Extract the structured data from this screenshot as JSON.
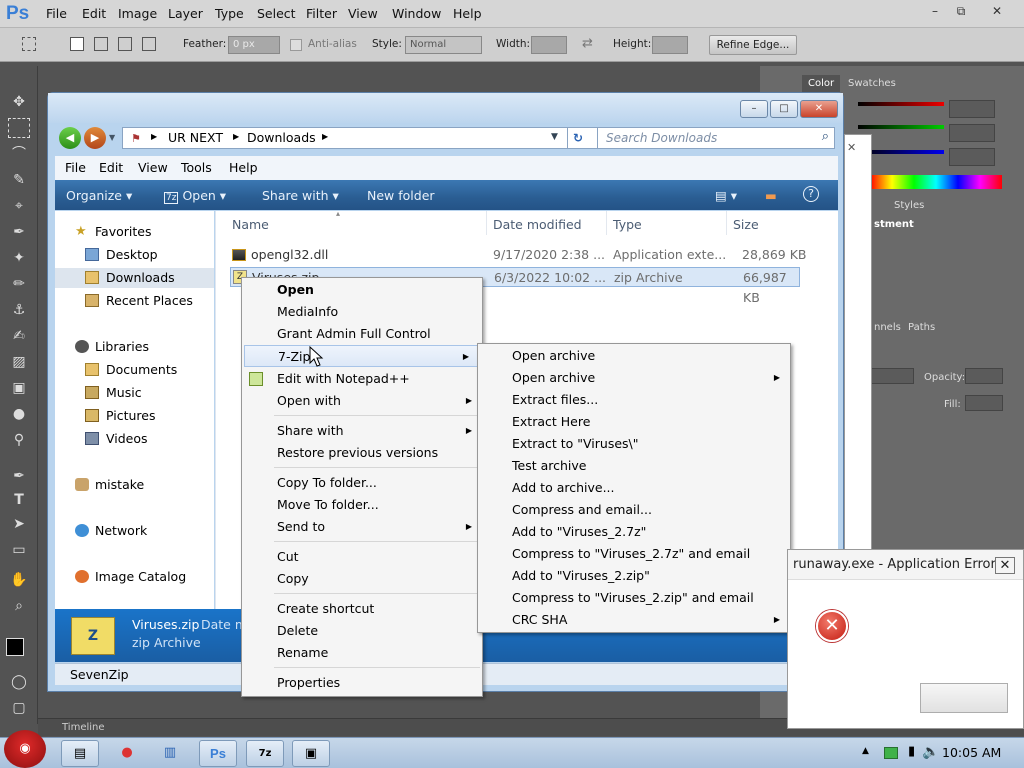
{
  "photoshop": {
    "logo": "Ps",
    "menus": [
      "File",
      "Edit",
      "Image",
      "Layer",
      "Type",
      "Select",
      "Filter",
      "View",
      "Window",
      "Help"
    ],
    "options": {
      "feather_label": "Feather:",
      "feather_value": "0 px",
      "antialias_label": "Anti-alias",
      "style_label": "Style:",
      "style_value": "Normal",
      "width_label": "Width:",
      "height_label": "Height:",
      "refine_edge": "Refine Edge..."
    },
    "panels": {
      "color_tab": "Color",
      "swatches_tab": "Swatches",
      "history_tab": "Styles",
      "adjustments_label": "stment",
      "channels_tab": "nnels",
      "paths_tab": "Paths",
      "opacity_label": "Opacity:",
      "fill_label": "Fill:"
    },
    "timeline": "Timeline"
  },
  "explorer": {
    "breadcrumb": [
      "UR NEXT",
      "Downloads"
    ],
    "search_placeholder": "Search Downloads",
    "menus": [
      "File",
      "Edit",
      "View",
      "Tools",
      "Help"
    ],
    "commands": {
      "organize": "Organize",
      "open": "Open",
      "share_with": "Share with",
      "new_folder": "New folder"
    },
    "nav": {
      "favorites": "Favorites",
      "desktop": "Desktop",
      "downloads": "Downloads",
      "recent": "Recent Places",
      "libraries": "Libraries",
      "documents": "Documents",
      "music": "Music",
      "pictures": "Pictures",
      "videos": "Videos",
      "mistake": "mistake",
      "network": "Network",
      "image_catalog": "Image Catalog"
    },
    "columns": {
      "name": "Name",
      "date": "Date modified",
      "type": "Type",
      "size": "Size"
    },
    "files": [
      {
        "name": "opengl32.dll",
        "date": "9/17/2020 2:38 ...",
        "type": "Application exte...",
        "size": "28,869 KB"
      },
      {
        "name": "Viruses.zip",
        "date": "6/3/2022 10:02 ...",
        "type": "zip Archive",
        "size": "66,987 KB"
      }
    ],
    "details": {
      "name": "Viruses.zip",
      "date_label": "Date m",
      "type": "zip Archive"
    },
    "status": "SevenZip"
  },
  "context_menu": {
    "items": {
      "open": "Open",
      "mediainfo": "MediaInfo",
      "grant": "Grant Admin Full Control",
      "sevenzip": "7-Zip",
      "notepad": "Edit with Notepad++",
      "open_with": "Open with",
      "share_with": "Share with",
      "restore": "Restore previous versions",
      "copy_to": "Copy To folder...",
      "move_to": "Move To folder...",
      "send_to": "Send to",
      "cut": "Cut",
      "copy": "Copy",
      "create_shortcut": "Create shortcut",
      "delete": "Delete",
      "rename": "Rename",
      "properties": "Properties"
    }
  },
  "sevenzip_menu": [
    "Open archive",
    "Open archive",
    "Extract files...",
    "Extract Here",
    "Extract to \"Viruses\\\"",
    "Test archive",
    "Add to archive...",
    "Compress and email...",
    "Add to \"Viruses_2.7z\"",
    "Compress to \"Viruses_2.7z\" and email",
    "Add to \"Viruses_2.zip\"",
    "Compress to \"Viruses_2.zip\" and email",
    "CRC SHA"
  ],
  "error_dialog": {
    "title": "runaway.exe - Application Error"
  },
  "taskbar": {
    "clock": "10:05 AM"
  }
}
